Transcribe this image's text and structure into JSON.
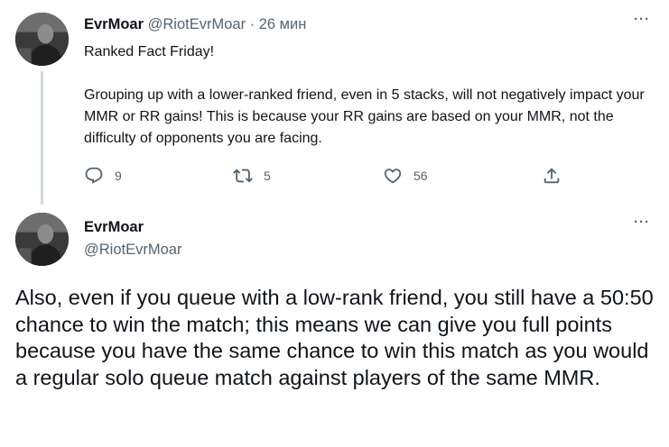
{
  "tweet1": {
    "author": {
      "display_name": "EvrMoar",
      "handle": "@RiotEvrMoar"
    },
    "separator": "·",
    "timestamp": "26 мин",
    "more_label": "···",
    "text_line1": "Ranked Fact Friday!",
    "text_line2": "Grouping up with a lower-ranked friend, even in 5 stacks, will not negatively impact your MMR or RR gains! This is because your RR gains are based on your MMR, not the difficulty of opponents you are facing.",
    "actions": {
      "reply_count": "9",
      "retweet_count": "5",
      "like_count": "56"
    }
  },
  "tweet2": {
    "author": {
      "display_name": "EvrMoar",
      "handle": "@RiotEvrMoar"
    },
    "more_label": "···",
    "text": "Also, even if you queue with a low-rank friend, you still have a 50:50 chance to win the match; this means we can give you full points because you have the same chance to win this match as you would a regular solo queue match against players of the same MMR."
  },
  "colors": {
    "text_primary": "#0f1419",
    "text_secondary": "#536471",
    "thread_line": "#cfd9de",
    "background": "#ffffff"
  },
  "icons": {
    "reply": "reply-icon",
    "retweet": "retweet-icon",
    "like": "heart-icon",
    "share": "share-icon",
    "more": "more-icon"
  }
}
